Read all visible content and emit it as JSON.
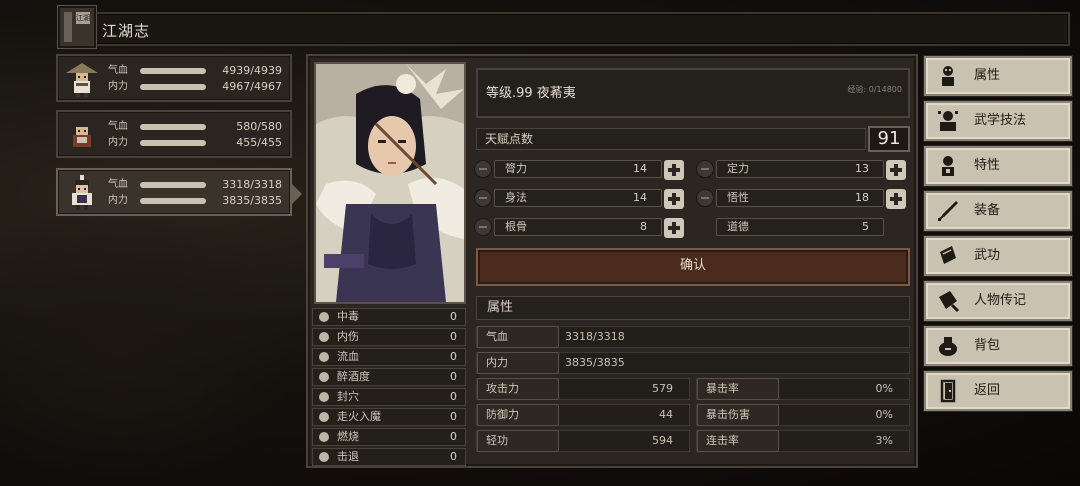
{
  "title": "江湖志",
  "book_label": "江湖",
  "party": [
    {
      "hp_label": "气血",
      "hp": "4939/4939",
      "mp_label": "内力",
      "mp": "4967/4967"
    },
    {
      "hp_label": "气血",
      "hp": "580/580",
      "mp_label": "内力",
      "mp": "455/455"
    },
    {
      "hp_label": "气血",
      "hp": "3318/3318",
      "mp_label": "内力",
      "mp": "3835/3835"
    }
  ],
  "character": {
    "level_name": "等级.99  夜莃夷",
    "exp": "经验: 0/14800",
    "talent_label": "天赋点数",
    "talent_value": "91"
  },
  "status_effects": [
    {
      "label": "中毒",
      "value": "0"
    },
    {
      "label": "内伤",
      "value": "0"
    },
    {
      "label": "流血",
      "value": "0"
    },
    {
      "label": "醉酒度",
      "value": "0"
    },
    {
      "label": "封穴",
      "value": "0"
    },
    {
      "label": "走火入魔",
      "value": "0"
    },
    {
      "label": "燃烧",
      "value": "0"
    },
    {
      "label": "击退",
      "value": "0"
    }
  ],
  "attributes": {
    "bili": {
      "label": "膂力",
      "value": "14"
    },
    "dingli": {
      "label": "定力",
      "value": "13"
    },
    "shenfa": {
      "label": "身法",
      "value": "14"
    },
    "wuxing": {
      "label": "悟性",
      "value": "18"
    },
    "gengu": {
      "label": "根骨",
      "value": "8"
    },
    "daode": {
      "label": "道德",
      "value": "5"
    }
  },
  "confirm_label": "确认",
  "props_title": "属性",
  "props": {
    "hp": {
      "label": "气血",
      "value": "3318/3318"
    },
    "mp": {
      "label": "内力",
      "value": "3835/3835"
    },
    "atk": {
      "label": "攻击力",
      "value": "579"
    },
    "crit": {
      "label": "暴击率",
      "value": "0%"
    },
    "def": {
      "label": "防御力",
      "value": "44"
    },
    "critdmg": {
      "label": "暴击伤害",
      "value": "0%"
    },
    "qinggong": {
      "label": "轻功",
      "value": "594"
    },
    "combo": {
      "label": "连击率",
      "value": "3%"
    }
  },
  "menu": [
    {
      "label": "属性",
      "icon": "person-icon"
    },
    {
      "label": "武学技法",
      "icon": "martial-arts-icon"
    },
    {
      "label": "特性",
      "icon": "trait-icon"
    },
    {
      "label": "装备",
      "icon": "sword-icon"
    },
    {
      "label": "武功",
      "icon": "scroll-icon"
    },
    {
      "label": "人物传记",
      "icon": "biography-icon"
    },
    {
      "label": "背包",
      "icon": "bag-icon"
    },
    {
      "label": "返回",
      "icon": "door-icon"
    }
  ],
  "colors": {
    "panel": "#2b2622",
    "confirm": "#4a2b1e",
    "menu": "#c9c2b1"
  }
}
